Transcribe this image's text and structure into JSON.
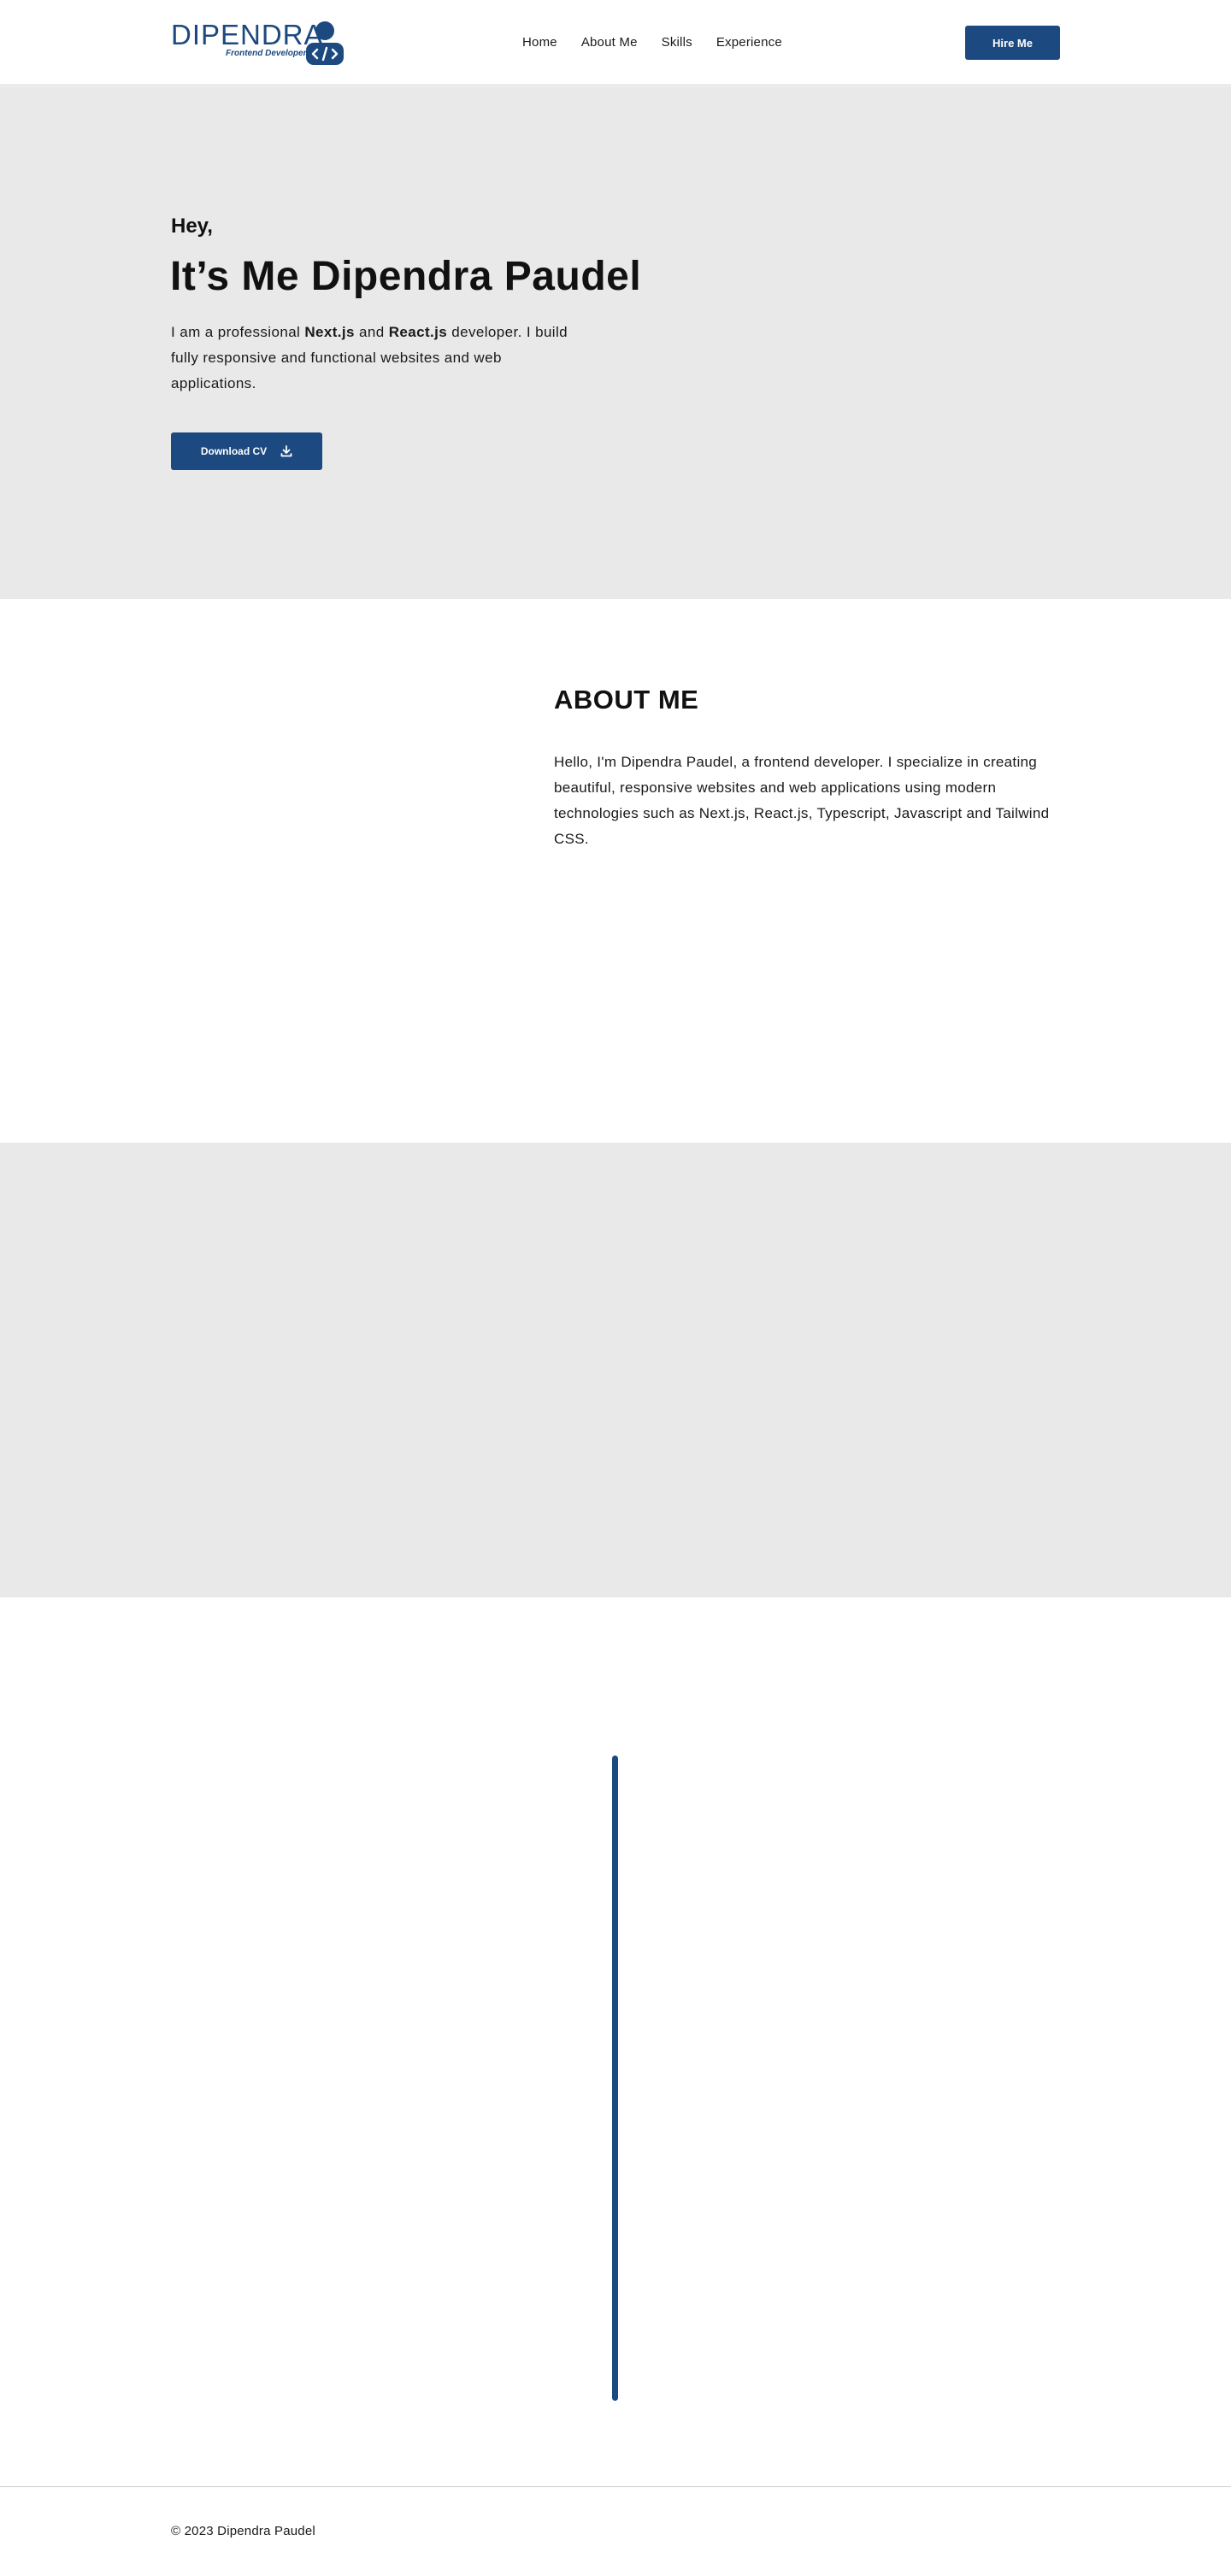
{
  "header": {
    "logo": {
      "name": "DIPENDRA",
      "tagline": "Frontend Developer",
      "icon": "developer-avatar-code-icon"
    },
    "nav": [
      "Home",
      "About Me",
      "Skills",
      "Experience"
    ],
    "hire_label": "Hire Me"
  },
  "hero": {
    "greeting": "Hey,",
    "title": "It’s Me Dipendra Paudel",
    "description": {
      "part1": "I am a professional ",
      "bold1": "Next.js",
      "part2": " and ",
      "bold2": "React.js",
      "part3": " developer. I build fully responsive and functional websites and web applications."
    },
    "cv_label": "Download CV",
    "cv_icon": "download-icon"
  },
  "about": {
    "title": "ABOUT ME",
    "text": "Hello, I'm Dipendra Paudel, a frontend developer. I specialize in creating beautiful, responsive websites and web applications using modern technologies such as Next.js, React.js, Typescript, Javascript and Tailwind CSS."
  },
  "footer": {
    "copyright": "© 2023 Dipendra Paudel"
  },
  "colors": {
    "accent": "#1c4a80",
    "section_gray": "#e9e9e9",
    "text": "#111111"
  }
}
